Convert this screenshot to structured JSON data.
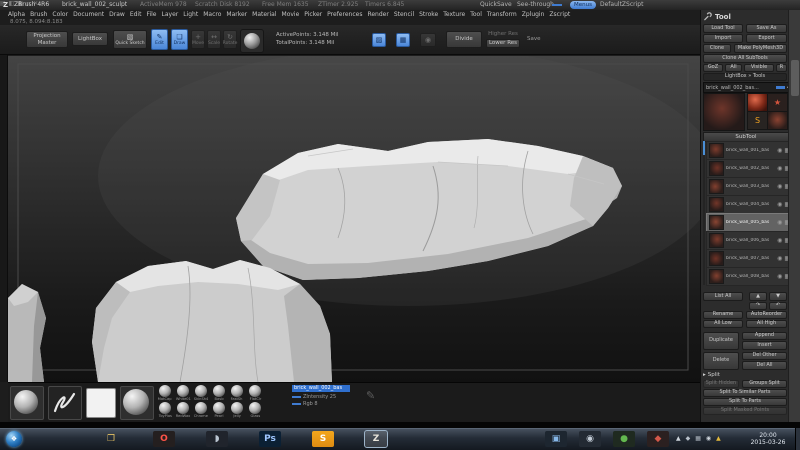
{
  "colors": {
    "accent": "#4a8fd6",
    "selection": "#2f6fce",
    "panel": "#2c2c2c",
    "canvas_top": "#444444",
    "canvas_bottom": "#111111",
    "rock": "#d2d2d2",
    "taskbar": "#242c37"
  },
  "title_bar": {
    "logo": "Z",
    "app": "ZBrush 4R6",
    "document": "brick_wall_002_sculpt",
    "stats": {
      "active_mem": "ActiveMem 978",
      "scratch_disk": "Scratch Disk 8192",
      "free_mem": "Free Mem 1635",
      "ztimer": "ZTimer 2.925",
      "timers": "Timers 6.845"
    },
    "quicksave": "QuickSave",
    "see_through": "See-through",
    "menus": "Menus",
    "default_zscript": "DefaultZScript",
    "window_icons": [
      "▤",
      "◧",
      "▣",
      "▫",
      "✕"
    ]
  },
  "menu_bar": [
    "Alpha",
    "Brush",
    "Color",
    "Document",
    "Draw",
    "Edit",
    "File",
    "Layer",
    "Light",
    "Macro",
    "Marker",
    "Material",
    "Movie",
    "Picker",
    "Preferences",
    "Render",
    "Stencil",
    "Stroke",
    "Texture",
    "Tool",
    "Transform",
    "Zplugin",
    "Zscript"
  ],
  "coords_readout": "8.075, 8.094:8.183",
  "top_shelf": {
    "projection_master": "Projection Master",
    "lightbox": "LightBox",
    "quick_sketch": "Quick Sketch",
    "edit": "Edit",
    "draw": "Draw",
    "move": "Move",
    "scale": "Scale",
    "rotate": "Rotate",
    "icons": {
      "edit": "✎",
      "draw": "❏",
      "move": "+",
      "scale": "↔",
      "rotate": "↻",
      "quick_sketch": "▧"
    },
    "active_points": "ActivePoints: 3.148 Mil",
    "total_points": "TotalPoints: 3.148 Mil",
    "divide": "Divide",
    "higher_res": "Higher Res",
    "lower_res": "Lower Res",
    "save": "Save"
  },
  "bottom_shelf": {
    "materials_row1": [
      "MatCap",
      "White01",
      "SkinSh4",
      "Basic",
      "FastSh",
      "FlatClr"
    ],
    "materials_row2": [
      "ToyPlas",
      "RedWax",
      "Chrome",
      "Pearl",
      "Jelly",
      "Glass"
    ],
    "popup": {
      "selected_text": "brick_wall_002_bas",
      "row2": "ZIntensity 25",
      "row3": "Rgb 8"
    },
    "pen_icon": "✎"
  },
  "tool_panel": {
    "header": "Tool",
    "load_tool": "Load Tool",
    "save_as": "Save As",
    "import": "Import",
    "export": "Export",
    "clone": "Clone",
    "make_polymesh": "Make PolyMesh3D",
    "clone_all": "Clone All SubTools",
    "goz": "GoZ",
    "all": "All",
    "visible": "Visible",
    "r": "R",
    "lightbox_tools": "LightBox » Tools",
    "tool_name": "brick_wall_002_bas...",
    "tool_badge": "4",
    "thumbs": [
      {
        "name": "sphere3d-thumb",
        "glyph": "",
        "fg": "#ffffff",
        "bg": "radial-gradient(circle at 38% 32%, #e06a4c, #7e2817 55%, #40140c 85%)"
      },
      {
        "name": "star3d-thumb",
        "glyph": "★",
        "fg": "#d6553e",
        "bg": "#2a201e"
      },
      {
        "name": "simplebrush-thumb",
        "glyph": "S",
        "fg": "#f2a321",
        "bg": "#282422"
      },
      {
        "name": "rock3d-thumb",
        "glyph": "",
        "fg": "#ffffff",
        "bg": "radial-gradient(circle at 50% 45%, #8a4231, #2b1d1a 75%)"
      }
    ]
  },
  "subtool": {
    "header": "SubTool",
    "eye_icon": "◉",
    "frame_icon": "▦",
    "items": [
      {
        "name": "brick_wall_001_bas",
        "thumb": "radial-gradient(circle at 45% 40%, #7c3b2c, #2c1e1b 72%)"
      },
      {
        "name": "brick_wall_002_bas",
        "thumb": "radial-gradient(circle at 55% 45%, #6e3226, #281c1a 72%)"
      },
      {
        "name": "brick_wall_003_bas",
        "thumb": "radial-gradient(circle at 40% 50%, #83402f, #2c1e1b 72%)"
      },
      {
        "name": "brick_wall_004_bas",
        "thumb": "radial-gradient(circle at 50% 40%, #733629, #281c1a 72%)"
      },
      {
        "name": "brick_wall_005_bas",
        "thumb": "radial-gradient(circle at 45% 45%, #8a4533, #2e1f1c 72%)",
        "selected": true
      },
      {
        "name": "brick_wall_006_bas",
        "thumb": "radial-gradient(circle at 55% 40%, #7c3b2c, #2a1d1b 72%)"
      },
      {
        "name": "brick_wall_007_bas",
        "thumb": "radial-gradient(circle at 45% 50%, #6e3226, #281c1a 72%)"
      },
      {
        "name": "brick_wall_008_bas",
        "thumb": "radial-gradient(circle at 50% 45%, #83402f, #2c1e1b 72%)"
      }
    ]
  },
  "actions": {
    "list_all": "List All",
    "up": "▲",
    "down": "▼",
    "copy": "↷",
    "paste": "↶",
    "rename": "Rename",
    "autoreorder": "AutoReorder",
    "all_low": "All Low",
    "all_high": "All High",
    "duplicate": "Duplicate",
    "append": "Append",
    "insert": "Insert",
    "delete": "Delete",
    "del_other": "Del Other",
    "del_all": "Del All"
  },
  "split": {
    "header": "Split",
    "split_hidden": "Split Hidden",
    "groups_split": "Groups Split",
    "split_similar": "Split To Similar Parts",
    "split_to_parts": "Split To Parts",
    "split_masked": "Split Masked Points"
  },
  "taskbar": {
    "start_glyph": "❖",
    "pinned": [
      {
        "name": "folder",
        "glyph": "❐",
        "fg": "#e5c162",
        "bg": "transparent"
      },
      {
        "name": "opera",
        "glyph": "O",
        "fg": "#ff5348",
        "bg": "#241f1f"
      },
      {
        "name": "media-app",
        "glyph": "◗",
        "fg": "#b9c4d0",
        "bg": "#20242c"
      },
      {
        "name": "photoshop",
        "glyph": "Ps",
        "fg": "#9fc6ff",
        "bg": "#0b2034"
      },
      {
        "name": "skype",
        "glyph": "S",
        "fg": "#ffffff",
        "bg": "linear-gradient(#f4a71d,#de8c12)"
      },
      {
        "name": "zbrush",
        "glyph": "Z",
        "fg": "#e8e4da",
        "bg": "#3d4148",
        "active": true
      }
    ],
    "running": [
      {
        "name": "player",
        "glyph": "▣",
        "fg": "#86b7e8",
        "bg": "#1d2630"
      },
      {
        "name": "viewer",
        "glyph": "◉",
        "fg": "#c3ccd6",
        "bg": "#232a33"
      },
      {
        "name": "antivirus",
        "glyph": "●",
        "fg": "#63b84f",
        "bg": "#1f2a20"
      },
      {
        "name": "downloader",
        "glyph": "◆",
        "fg": "#d4584a",
        "bg": "#2b2020"
      }
    ],
    "tray": [
      {
        "name": "tray-expand",
        "glyph": "▲",
        "fg": "#cfd5dc"
      },
      {
        "name": "tray-app-1",
        "glyph": "◆",
        "fg": "#b9c1ca"
      },
      {
        "name": "tray-network",
        "glyph": "▦",
        "fg": "#aeb6bf"
      },
      {
        "name": "tray-volume",
        "glyph": "◉",
        "fg": "#cfd5dc"
      },
      {
        "name": "tray-drive",
        "glyph": "▲",
        "fg": "#e3b93c"
      }
    ],
    "time": "20:00",
    "date": "2015-03-26"
  }
}
